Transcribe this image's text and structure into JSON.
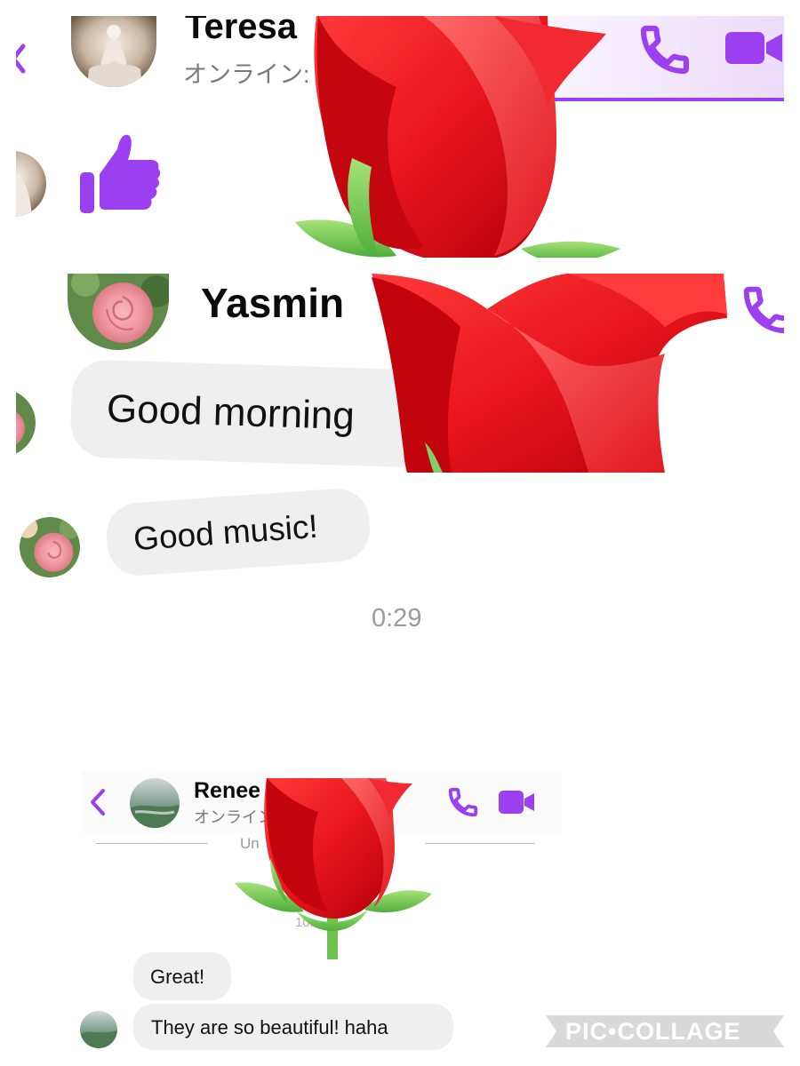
{
  "accent_color": "#9b3ff0",
  "collage_brand": "PIC•COLLAGE",
  "panel_teresa": {
    "contact_name": "Teresa",
    "status": "オンライン: 1",
    "icons": [
      "back-chevron-icon",
      "phone-icon",
      "video-camera-icon",
      "thumbs-up-icon"
    ]
  },
  "panel_yasmin": {
    "contact_name": "Yasmin",
    "messages": [
      "Good morning",
      "Good music!"
    ],
    "voice_duration": "0:29",
    "icons": [
      "phone-icon"
    ]
  },
  "panel_renee": {
    "contact_name": "Renee",
    "status": "オンライン",
    "divider_text": "Un",
    "timestamp_fragment": "10:",
    "messages": [
      "Great!",
      "They are so beautiful! haha"
    ],
    "icons": [
      "back-chevron-icon",
      "phone-icon",
      "video-camera-icon"
    ]
  },
  "sticker": "red-rose"
}
